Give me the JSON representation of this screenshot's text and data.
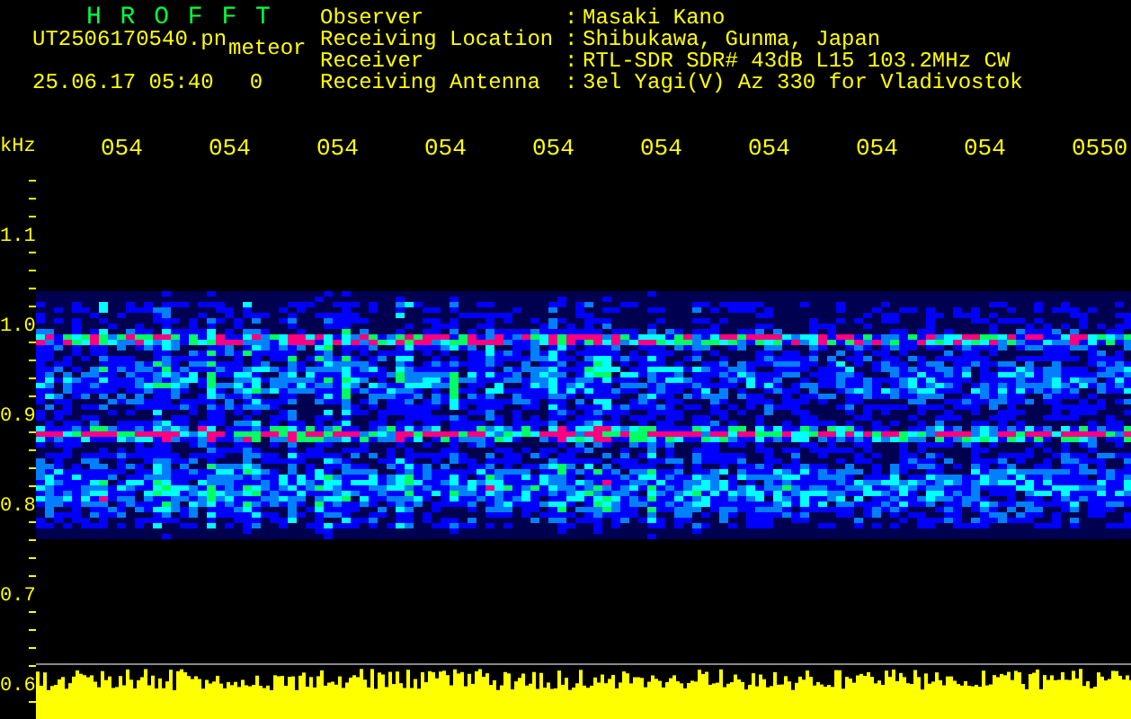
{
  "header": {
    "title": "H R O F F T",
    "file_name": "UT2506170540.pn",
    "mode": "meteor",
    "timestamp": "25.06.17 05:40",
    "count": "0"
  },
  "info": [
    {
      "label": "Observer",
      "separator": ":",
      "value": "Masaki Kano"
    },
    {
      "label": "Receiving Location",
      "separator": ":",
      "value": "Shibukawa, Gunma, Japan"
    },
    {
      "label": "Receiver",
      "separator": ":",
      "value": "RTL-SDR SDR# 43dB L15 103.2MHz CW"
    },
    {
      "label": "Receiving Antenna",
      "separator": ":",
      "value": "3el Yagi(V) Az 330 for Vladivostok"
    }
  ],
  "axis": {
    "unit": "kHz",
    "x_labels": [
      "054",
      "054",
      "054",
      "054",
      "054",
      "054",
      "054",
      "054",
      "054",
      "0550"
    ],
    "y_labels": [
      "1.1",
      "1.0",
      "0.9",
      "0.8",
      "0.7",
      "0.6"
    ]
  }
}
